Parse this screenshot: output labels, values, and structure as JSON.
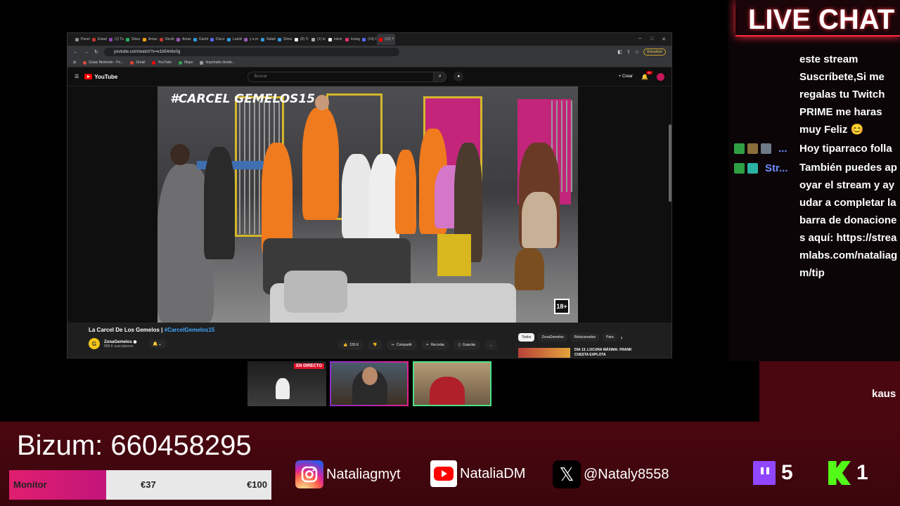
{
  "chat": {
    "title": "LIVE CHAT",
    "message1": "este stream Suscríbete,Si me regalas tu Twitch PRIME me haras muy Feliz 😊",
    "row2_user": "...",
    "row2_msg": "Hoy tiparraco folla",
    "row3_user": "Str...",
    "row3_msg": "También puedes apoyar el stream y ayudar a completar la barra de donaciones aquí: https://streamlabs.com/nataliagm/tip",
    "scroll_name": "kaus"
  },
  "browser": {
    "tabs": [
      "Panel",
      "Estadí",
      "(1) Tu",
      "Strea",
      "Amaz",
      "Recibi",
      "Amaz",
      "Dashb",
      "Disco",
      "Ludoli",
      "y a m",
      "Natali",
      "Strea",
      "(8) Tr",
      "(1) In",
      "inicio",
      "Instag",
      "(14) C",
      "(23) Y"
    ],
    "url": "youtube.com/watch?v=e1b54n6x0g",
    "update_label": "Actualizar",
    "bookmarks": [
      "Guias Nintendo - Po...",
      "Gmail",
      "YouTube",
      "Maps",
      "Importado desde..."
    ]
  },
  "youtube": {
    "logo": "YouTube",
    "search_placeholder": "Buscar",
    "create_label": "Crear",
    "notif_count": "9+",
    "video_title": "La Carcel De Los Gemelos | ",
    "video_tag": "#CarcelGemelos15",
    "channel_name": "ZonaGemelos",
    "channel_subs": "858 K suscriptores",
    "likes": "155 K",
    "share": "Compartir",
    "clip": "Recortar",
    "save": "Guardar",
    "more": "...",
    "chips": [
      "Todos",
      "ZonaGemelos",
      "Relacionados",
      "Para"
    ],
    "reco_title": "DIA 13. LOCURA MÁXIMA: FRANK CUESTA EXPLOTA",
    "video_overlay": "#CARCEL GEMELOS15",
    "rating": "18+"
  },
  "webcam": {
    "live_badge": "EN DIRECTO"
  },
  "donation": {
    "bizum": "Bizum: 660458295",
    "label": "Monitor",
    "current": "€37",
    "target": "€100",
    "progress": 0.37
  },
  "socials": {
    "instagram": "Nataliagmyt",
    "youtube": "NataliaDM",
    "x": "@Nataly8558"
  },
  "stats": {
    "twitch": "5",
    "kick": "1"
  },
  "colors": {
    "accent": "#ff2a3d",
    "goal_fill": "#e01e6e",
    "twitch": "#9146ff",
    "kick": "#53fc18"
  }
}
